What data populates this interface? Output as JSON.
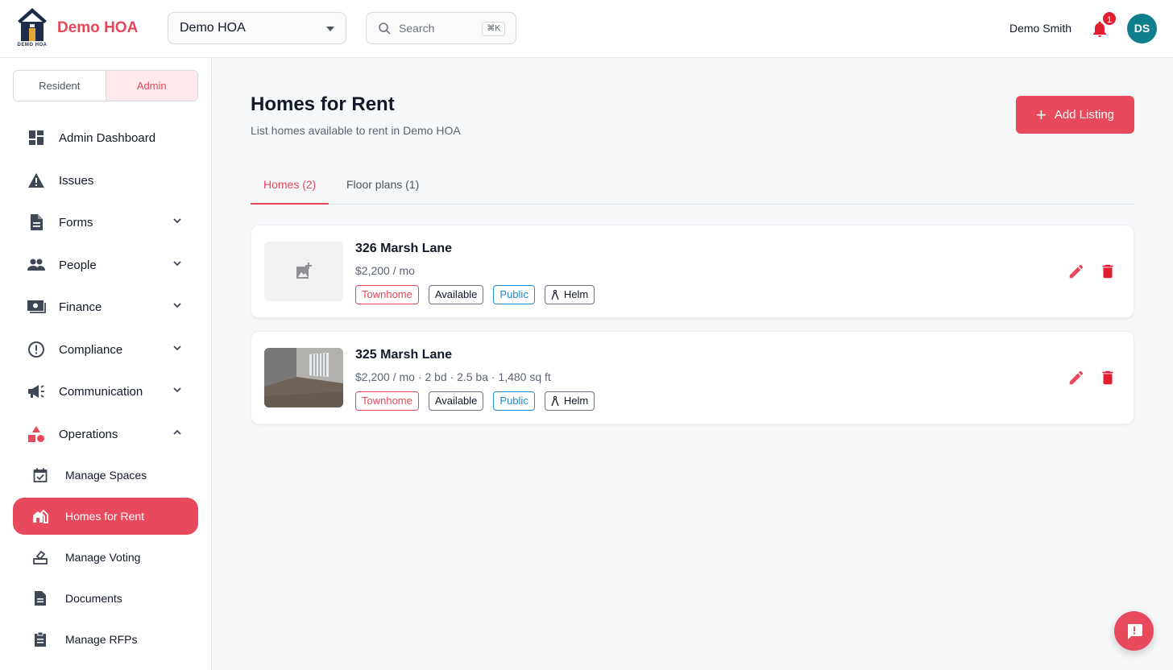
{
  "brand": {
    "name": "Demo HOA",
    "logo_text": "DEMO HOA"
  },
  "header": {
    "hoa_select": {
      "value": "Demo HOA"
    },
    "search": {
      "placeholder": "Search",
      "shortcut": "⌘K"
    },
    "user_name": "Demo Smith",
    "notification_count": "1",
    "avatar_initials": "DS"
  },
  "sidebar": {
    "role_toggle": {
      "resident": "Resident",
      "admin": "Admin",
      "active": "Admin"
    },
    "items": [
      {
        "label": "Admin Dashboard",
        "icon": "dashboard-icon"
      },
      {
        "label": "Issues",
        "icon": "warning-icon"
      },
      {
        "label": "Forms",
        "icon": "document-icon",
        "expandable": true
      },
      {
        "label": "People",
        "icon": "people-icon",
        "expandable": true
      },
      {
        "label": "Finance",
        "icon": "money-icon",
        "expandable": true
      },
      {
        "label": "Compliance",
        "icon": "alert-circle-icon",
        "expandable": true
      },
      {
        "label": "Communication",
        "icon": "megaphone-icon",
        "expandable": true
      },
      {
        "label": "Operations",
        "icon": "shapes-icon",
        "expanded": true
      }
    ],
    "sub_items": [
      {
        "label": "Manage Spaces",
        "icon": "calendar-check-icon"
      },
      {
        "label": "Homes for Rent",
        "icon": "homes-icon",
        "active": true
      },
      {
        "label": "Manage Voting",
        "icon": "ballot-icon"
      },
      {
        "label": "Documents",
        "icon": "file-icon"
      },
      {
        "label": "Manage RFPs",
        "icon": "clipboard-icon"
      }
    ]
  },
  "main": {
    "title": "Homes for Rent",
    "subtitle": "List homes available to rent in Demo HOA",
    "add_button": "Add Listing",
    "tabs": [
      {
        "label": "Homes (2)",
        "active": true
      },
      {
        "label": "Floor plans (1)"
      }
    ],
    "listings": [
      {
        "title": "326 Marsh Lane",
        "details": "$2,200 / mo",
        "has_photo": false,
        "tags": [
          "Townhome",
          "Available",
          "Public",
          "Helm"
        ]
      },
      {
        "title": "325 Marsh Lane",
        "details": "$2,200 / mo · 2 bd · 2.5 ba · 1,480 sq ft",
        "has_photo": true,
        "tags": [
          "Townhome",
          "Available",
          "Public",
          "Helm"
        ]
      }
    ]
  },
  "colors": {
    "accent": "#e8495c",
    "public_tag": "#1f8ad6",
    "avatar": "#0f7f8c",
    "badge": "#e11d2f"
  }
}
